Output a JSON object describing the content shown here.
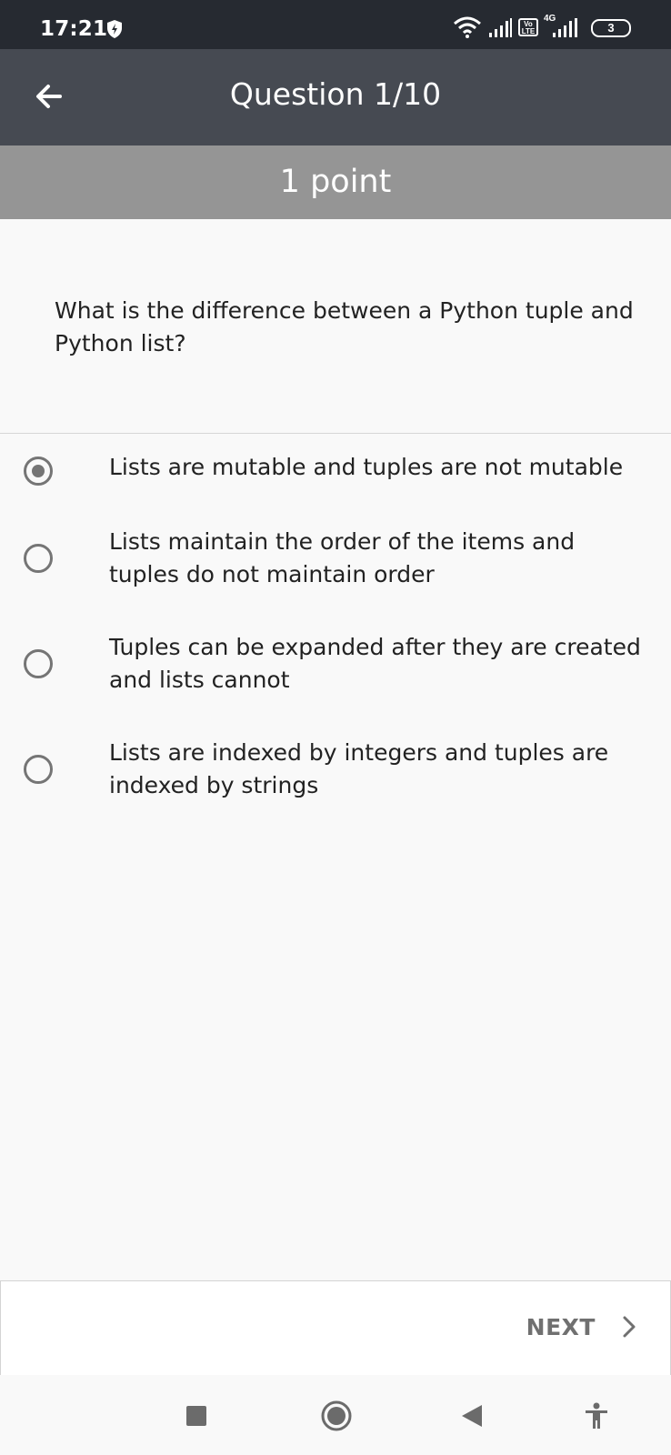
{
  "status_bar": {
    "time": "17:21",
    "volte_label": "Vo LTE",
    "network_label": "4G",
    "battery_level": "3",
    "icons": [
      "shield-icon",
      "wifi-icon",
      "signal-icon",
      "volte-icon",
      "signal-4g-icon",
      "battery-icon"
    ]
  },
  "header": {
    "title": "Question 1/10",
    "back_icon": "arrow-left-icon"
  },
  "points": {
    "label": "1 point"
  },
  "question": {
    "text": "What is the difference between a Python tuple and Python list?"
  },
  "options": [
    {
      "label": "Lists are mutable and tuples are not mutable",
      "selected": true
    },
    {
      "label": "Lists maintain the order of the items and tuples do not maintain order",
      "selected": false
    },
    {
      "label": "Tuples can be expanded after they are created and lists cannot",
      "selected": false
    },
    {
      "label": "Lists are indexed by integers and tuples are indexed by strings",
      "selected": false
    }
  ],
  "footer": {
    "next_label": "NEXT",
    "next_icon": "chevron-right-icon"
  },
  "nav_bar": {
    "icons": [
      "recents-square-icon",
      "home-circle-icon",
      "back-triangle-icon",
      "accessibility-icon"
    ]
  },
  "colors": {
    "status_bar": "#262a31",
    "header": "#464a52",
    "points_bar": "#959595",
    "radio": "#757575",
    "background": "#f9f9f9"
  }
}
